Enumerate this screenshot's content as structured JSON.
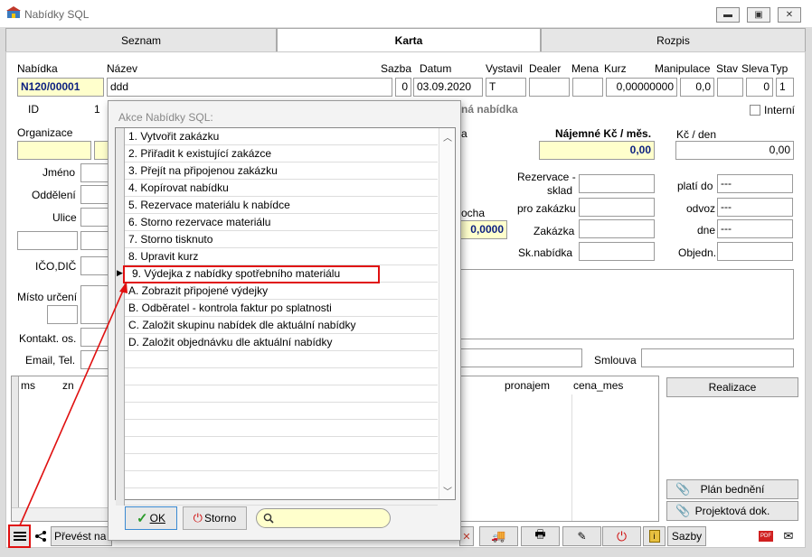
{
  "window": {
    "title": "Nabídky SQL"
  },
  "tabs": [
    {
      "label": "Seznam"
    },
    {
      "label": "Karta"
    },
    {
      "label": "Rozpis"
    }
  ],
  "header": {
    "nabidka_label": "Nabídka",
    "nabidka_value": "N120/00001",
    "nazev_label": "Název",
    "nazev_value": "ddd",
    "sazba_label": "Sazba",
    "sazba_value": "0",
    "datum_label": "Datum",
    "datum_value": "03.09.2020",
    "vystavil_label": "Vystavil",
    "vystavil_value": "T",
    "dealer_label": "Dealer",
    "mena_label": "Mena",
    "kurz_label": "Kurz",
    "kurz_value": "0,00000000",
    "manipulace_label": "Manipulace",
    "manipulace_value": "0,0",
    "stav_label": "Stav",
    "sleva_label": "Sleva",
    "sleva_value": "0",
    "typ_label": "Typ",
    "typ_value": "1",
    "id_label": "ID",
    "id_value": "1",
    "nabidka_type": "ná nabídka",
    "interni_label": "Interní"
  },
  "left": {
    "organizace": "Organizace",
    "jmeno": "Jméno",
    "oddeleni": "Oddělení",
    "ulice": "Ulice",
    "ico": "IČO,DIČ",
    "misto": "Místo určení",
    "kontakt": "Kontakt. os.",
    "email": "Email, Tel."
  },
  "right": {
    "najemne_label": "Nájemné Kč / měs.",
    "najemne_value": "0,00",
    "kc_den_label": "Kč / den",
    "kc_den_value": "0,00",
    "a_partial": "a",
    "rezervace_label1": "Rezervace -",
    "rezervace_label2": "sklad",
    "pro_zakazku": "pro zakázku",
    "zakazka": "Zakázka",
    "sknabidka": "Sk.nabídka",
    "plati_do": "platí do",
    "plati_do_value": "---",
    "odvoz": "odvoz",
    "odvoz_value": "---",
    "dne": "dne",
    "dne_value": "---",
    "objedn": "Objedn.",
    "plocha_partial": "ocha",
    "plocha_value": "0,0000",
    "smlouva": "Smlouva"
  },
  "grid": {
    "columns": [
      "ms",
      "zn",
      "pronajem",
      "cena_mes"
    ]
  },
  "side_buttons": {
    "realizace": "Realizace",
    "plan": "Plán bednění",
    "projekt": "Projektová dok."
  },
  "toolbar": {
    "prevest": "Převést na",
    "sazby": "Sazby"
  },
  "dialog": {
    "title": "Akce Nabídky SQL:",
    "items": [
      "1. Vytvořit zakázku",
      "2. Přiřadit k existující zakázce",
      "3. Přejít na připojenou zakázku",
      "4. Kopírovat nabídku",
      "5. Rezervace materiálu k nabídce",
      "6. Storno rezervace materiálu",
      "7. Storno tisknuto",
      "8. Upravit kurz",
      "9. Výdejka z nabídky spotřebního materiálu",
      "A. Zobrazit připojené výdejky",
      "B. Odběratel - kontrola faktur po splatnosti",
      "C. Založit skupinu nabídek dle aktuální nabídky",
      "D. Založit objednávku dle aktuální nabídky"
    ],
    "selected_index": 8,
    "ok_label": "OK",
    "storno_label": "Storno",
    "search_value": ""
  },
  "colors": {
    "highlight": "#e01010",
    "yellow_field": "#ffffcc",
    "navy_text": "#0b1f80"
  }
}
